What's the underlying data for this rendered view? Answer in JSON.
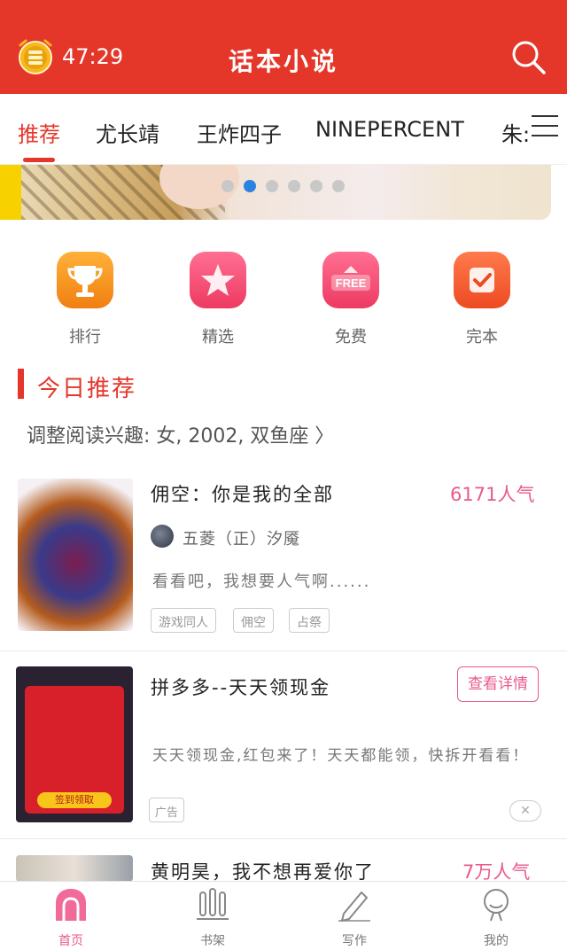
{
  "header": {
    "timer": "47:29",
    "title": "话本小说",
    "background_color": "#e5362a"
  },
  "tabs": [
    {
      "label": "推荐",
      "active": true
    },
    {
      "label": "尤长靖",
      "active": false
    },
    {
      "label": "王炸四子",
      "active": false
    },
    {
      "label": "NINEPERCENT",
      "active": false
    },
    {
      "label": "朱:",
      "active": false
    }
  ],
  "banner": {
    "dot_count": 6,
    "active_dot": 1
  },
  "quick_entries": [
    {
      "label": "排行",
      "icon": "trophy-icon",
      "color": "#f79a1c"
    },
    {
      "label": "精选",
      "icon": "star-icon",
      "color": "#f24a72"
    },
    {
      "label": "免费",
      "icon": "free-icon",
      "color": "#f24a72"
    },
    {
      "label": "完本",
      "icon": "check-icon",
      "color": "#f2552a"
    }
  ],
  "section": {
    "title": "今日推荐",
    "interest_text": "调整阅读兴趣: 女, 2002, 双鱼座 〉"
  },
  "items": [
    {
      "title": "佣空：你是我的全部",
      "popularity": "6171人气",
      "author": "五菱（正）汐魇",
      "description": "看看吧，我想要人气啊......",
      "tags": [
        "游戏同人",
        "佣空",
        "占祭"
      ]
    },
    {
      "title": "拼多多--天天领现金",
      "button": "查看详情",
      "description": "天天领现金,红包来了！天天都能领，快拆开看看！",
      "ad_label": "广告",
      "cover_text": "签到领取",
      "close": "✕"
    },
    {
      "title": "黄明昊，我不想再爱你了",
      "popularity": "7万人气"
    }
  ],
  "bottom_nav": [
    {
      "label": "首页",
      "icon": "home-icon",
      "active": true
    },
    {
      "label": "书架",
      "icon": "bookshelf-icon",
      "active": false
    },
    {
      "label": "写作",
      "icon": "pen-icon",
      "active": false
    },
    {
      "label": "我的",
      "icon": "profile-icon",
      "active": false
    }
  ],
  "colors": {
    "accent": "#e5362a",
    "pink": "#e85a8e",
    "dot_active": "#2a83e0"
  }
}
